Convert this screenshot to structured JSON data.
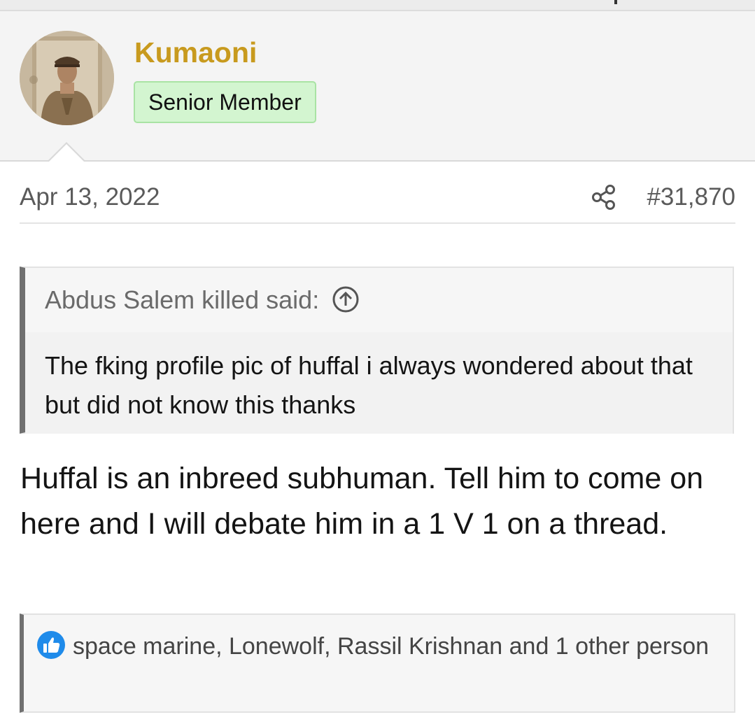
{
  "post": {
    "author": {
      "name": "Kumaoni",
      "title": "Senior Member",
      "avatar_icon": "member-photo-avatar"
    },
    "date": "Apr 13, 2022",
    "share_icon": "share-icon",
    "number": "#31,870",
    "quote": {
      "header": "Abdus Salem killed said:",
      "expand_icon": "arrow-up-circle-icon",
      "body": "The fking profile pic of huffal i always wondered about that but did not know this thanks"
    },
    "message": "Huffal is an inbreed subhuman. Tell him to come on here and I will debate him in a 1 V 1 on a thread.",
    "reactions": {
      "icon": "like-icon",
      "text": "space marine, Lonewolf, Rassil Krishnan and 1 other person"
    }
  },
  "colors": {
    "username": "#c89a1e",
    "badge_bg": "#d3f5d0",
    "like_blue": "#1f8bea"
  }
}
